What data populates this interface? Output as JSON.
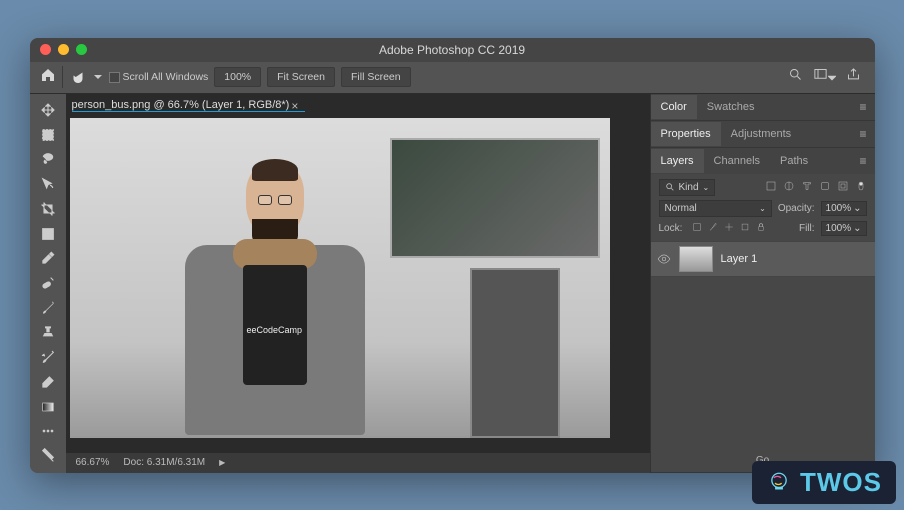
{
  "window": {
    "title": "Adobe Photoshop CC 2019"
  },
  "optionsbar": {
    "scroll_all_windows": "Scroll All Windows",
    "zoom_100": "100%",
    "fit_screen": "Fit Screen",
    "fill_screen": "Fill Screen"
  },
  "document": {
    "tab_label": "person_bus.png @ 66.7% (Layer 1, RGB/8*)",
    "shirt_text": "eeCodeCamp"
  },
  "statusbar": {
    "zoom": "66.67%",
    "doc_info": "Doc:  6.31M/6.31M"
  },
  "panels": {
    "color": {
      "tabs": [
        "Color",
        "Swatches"
      ]
    },
    "properties": {
      "tabs": [
        "Properties",
        "Adjustments"
      ]
    },
    "layers": {
      "tabs": [
        "Layers",
        "Channels",
        "Paths"
      ],
      "filter_label": "Kind",
      "blend_mode": "Normal",
      "opacity_label": "Opacity:",
      "opacity_value": "100%",
      "lock_label": "Lock:",
      "fill_label": "Fill:",
      "fill_value": "100%",
      "items": [
        {
          "name": "Layer 1",
          "visible": true
        }
      ]
    },
    "go_link": "Go"
  },
  "watermark": "TWOS"
}
